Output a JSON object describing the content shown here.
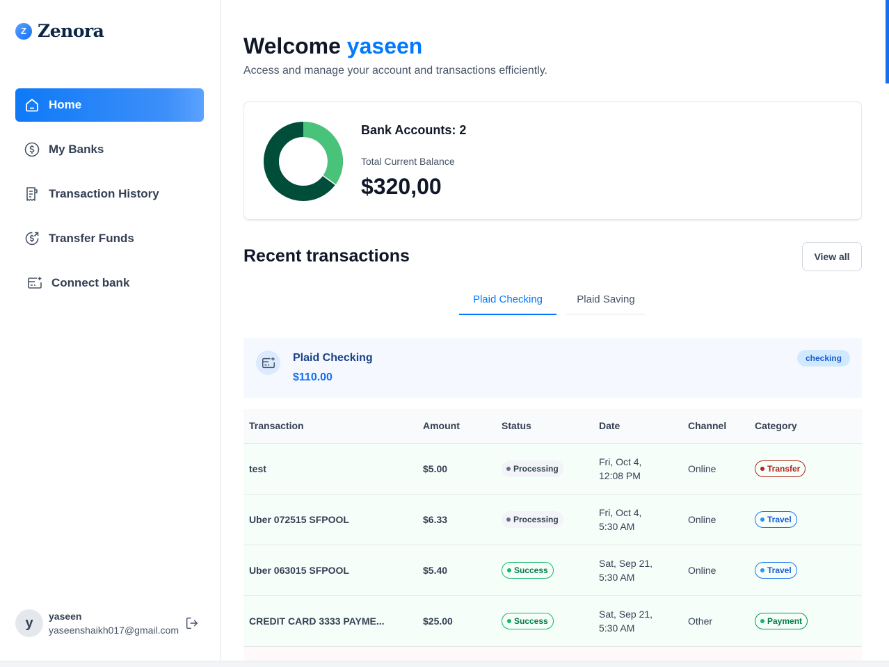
{
  "app": {
    "name": "Zenora"
  },
  "sidebar": {
    "items": [
      {
        "label": "Home",
        "icon": "home-icon",
        "active": true
      },
      {
        "label": "My Banks",
        "icon": "dollar-circle-icon",
        "active": false
      },
      {
        "label": "Transaction History",
        "icon": "receipt-icon",
        "active": false
      },
      {
        "label": "Transfer Funds",
        "icon": "money-send-icon",
        "active": false
      },
      {
        "label": "Connect bank",
        "icon": "card-plus-icon",
        "active": false
      }
    ],
    "user": {
      "initial": "y",
      "name": "yaseen",
      "email": "yaseenshaikh017@gmail.com"
    }
  },
  "header": {
    "greeting": "Welcome",
    "user_name": "yaseen",
    "subtitle": "Access and manage your account and transactions efficiently."
  },
  "balance": {
    "bank_accounts_label": "Bank Accounts: 2",
    "total_label": "Total Current Balance",
    "total_value": "$320,00",
    "donut_segments": [
      {
        "share": 0.35,
        "color": "#4ac37a"
      },
      {
        "share": 0.65,
        "color": "#004d3a"
      }
    ]
  },
  "recent": {
    "title": "Recent transactions",
    "view_all": "View all",
    "tabs": [
      {
        "label": "Plaid Checking",
        "active": true
      },
      {
        "label": "Plaid Saving",
        "active": false
      }
    ],
    "account": {
      "name": "Plaid Checking",
      "amount": "$110.00",
      "type": "checking"
    },
    "columns": [
      "Transaction",
      "Amount",
      "Status",
      "Date",
      "Channel",
      "Category"
    ],
    "rows": [
      {
        "name": "test",
        "amount": "$5.00",
        "status": "Processing",
        "status_kind": "processing",
        "date_line1": "Fri, Oct 4,",
        "date_line2": "12:08 PM",
        "channel": "Online",
        "category": "Transfer",
        "category_kind": "cat-transfer"
      },
      {
        "name": "Uber 072515 SFPOOL",
        "amount": "$6.33",
        "status": "Processing",
        "status_kind": "processing",
        "date_line1": "Fri, Oct 4,",
        "date_line2": "5:30 AM",
        "channel": "Online",
        "category": "Travel",
        "category_kind": "cat-travel"
      },
      {
        "name": "Uber 063015 SFPOOL",
        "amount": "$5.40",
        "status": "Success",
        "status_kind": "success",
        "date_line1": "Sat, Sep 21,",
        "date_line2": "5:30 AM",
        "channel": "Online",
        "category": "Travel",
        "category_kind": "cat-travel"
      },
      {
        "name": "CREDIT CARD 3333 PAYME...",
        "amount": "$25.00",
        "status": "Success",
        "status_kind": "success",
        "date_line1": "Sat, Sep 21,",
        "date_line2": "5:30 AM",
        "channel": "Other",
        "category": "Payment",
        "category_kind": "cat-payment"
      }
    ]
  },
  "colors": {
    "accent": "#0179fe",
    "success": "#039855",
    "transfer": "#b42318"
  }
}
